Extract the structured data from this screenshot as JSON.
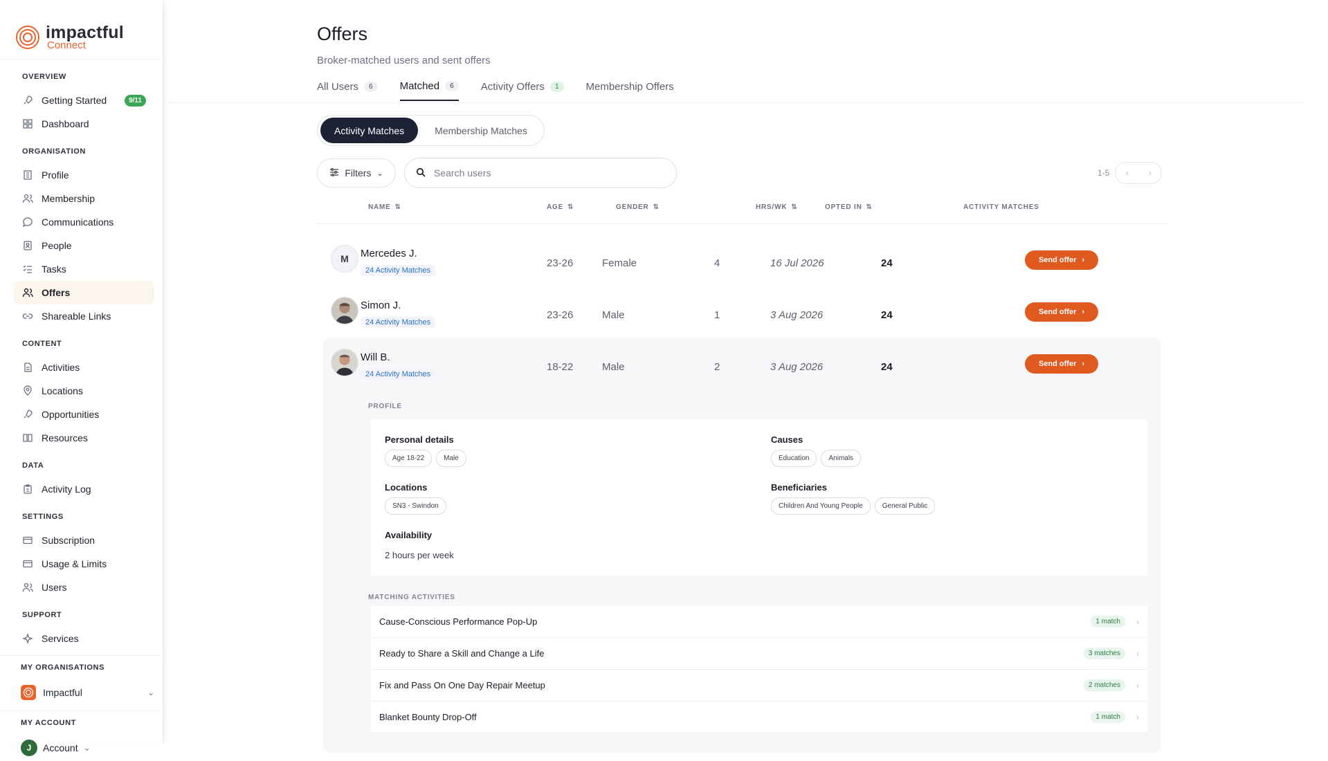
{
  "brand": {
    "name": "impactful",
    "sub": "Connect"
  },
  "sidebar": {
    "sections": {
      "overview": "OVERVIEW",
      "organisation": "ORGANISATION",
      "content": "CONTENT",
      "data": "DATA",
      "settings": "SETTINGS",
      "support": "SUPPORT",
      "my_orgs": "MY ORGANISATIONS",
      "my_account": "MY ACCOUNT"
    },
    "items": {
      "getting_started": "Getting Started",
      "getting_started_badge": "9/11",
      "dashboard": "Dashboard",
      "profile": "Profile",
      "membership": "Membership",
      "communications": "Communications",
      "people": "People",
      "tasks": "Tasks",
      "offers": "Offers",
      "shareable_links": "Shareable Links",
      "activities": "Activities",
      "locations": "Locations",
      "opportunities": "Opportunities",
      "resources": "Resources",
      "activity_log": "Activity Log",
      "subscription": "Subscription",
      "usage_limits": "Usage & Limits",
      "users": "Users",
      "services": "Services"
    },
    "org_name": "Impactful",
    "account_initial": "J",
    "account_label": "Account"
  },
  "page": {
    "title": "Offers",
    "subtitle": "Broker-matched users and sent offers"
  },
  "tabs": [
    {
      "label": "All Users",
      "count": "6"
    },
    {
      "label": "Matched",
      "count": "6"
    },
    {
      "label": "Activity Offers",
      "count": "1"
    },
    {
      "label": "Membership Offers",
      "count": ""
    }
  ],
  "segments": {
    "activity": "Activity Matches",
    "membership": "Membership Matches"
  },
  "toolbar": {
    "filters": "Filters",
    "search_placeholder": "Search users",
    "range": "1-5"
  },
  "columns": {
    "name": "NAME",
    "age": "AGE",
    "gender": "GENDER",
    "hrs": "HRS/WK",
    "opted": "OPTED IN",
    "matches": "ACTIVITY MATCHES"
  },
  "rows": [
    {
      "name": "Mercedes J.",
      "initial": "M",
      "sub": "24 Activity Matches",
      "age": "23-26",
      "gender": "Female",
      "hrs": "4",
      "opted": "16 Jul 2026",
      "matches": "24",
      "action": "Send offer"
    },
    {
      "name": "Simon J.",
      "initial": "",
      "sub": "24 Activity Matches",
      "age": "23-26",
      "gender": "Male",
      "hrs": "1",
      "opted": "3 Aug 2026",
      "matches": "24",
      "action": "Send offer"
    },
    {
      "name": "Will B.",
      "initial": "",
      "sub": "24 Activity Matches",
      "age": "18-22",
      "gender": "Male",
      "hrs": "2",
      "opted": "3 Aug 2026",
      "matches": "24",
      "action": "Send offer"
    }
  ],
  "profile": {
    "section": "PROFILE",
    "personal_label": "Personal details",
    "personal_chips": [
      "Age 18-22",
      "Male"
    ],
    "causes_label": "Causes",
    "causes_chips": [
      "Education",
      "Animals"
    ],
    "locations_label": "Locations",
    "locations_chips": [
      "SN3 - Swindon"
    ],
    "beneficiaries_label": "Beneficiaries",
    "beneficiaries_chips": [
      "Children And Young People",
      "General Public"
    ],
    "availability_label": "Availability",
    "availability_value": "2 hours per week"
  },
  "matching": {
    "section": "MATCHING ACTIVITIES",
    "items": [
      {
        "name": "Cause-Conscious Performance Pop-Up",
        "badge": "1 match"
      },
      {
        "name": "Ready to Share a Skill and Change a Life",
        "badge": "3 matches"
      },
      {
        "name": "Fix and Pass On One Day Repair Meetup",
        "badge": "2 matches"
      },
      {
        "name": "Blanket Bounty Drop-Off",
        "badge": "1 match"
      }
    ]
  },
  "colors": {
    "accent": "#e0591f",
    "brand": "#e8632a",
    "dark": "#1d2235",
    "green": "#3aa657"
  }
}
